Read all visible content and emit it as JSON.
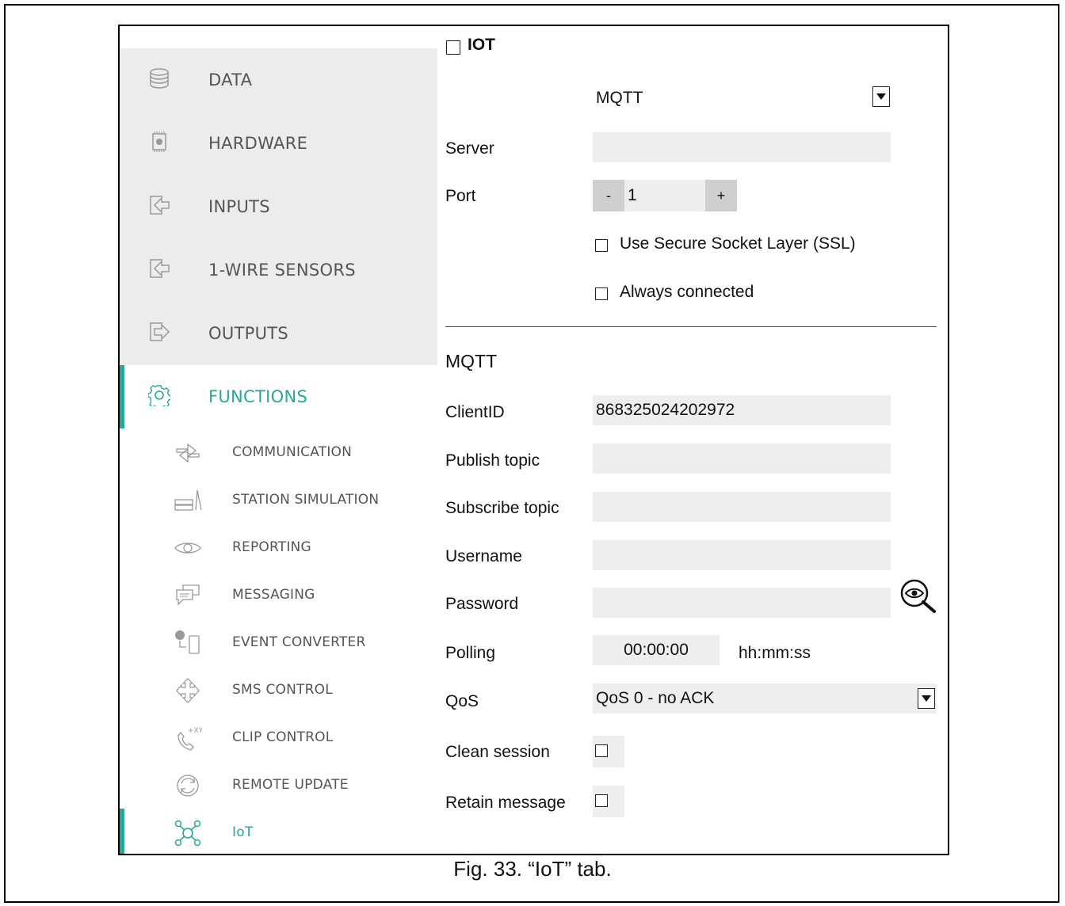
{
  "sidebar": {
    "main_items": [
      {
        "label": "DATA",
        "icon": "database-icon"
      },
      {
        "label": "HARDWARE",
        "icon": "chip-icon"
      },
      {
        "label": "INPUTS",
        "icon": "input-icon"
      },
      {
        "label": "1-WIRE SENSORS",
        "icon": "input-icon"
      },
      {
        "label": "OUTPUTS",
        "icon": "output-icon"
      },
      {
        "label": "FUNCTIONS",
        "icon": "gear-icon"
      }
    ],
    "sub_items": [
      {
        "label": "COMMUNICATION",
        "icon": "communication-icon"
      },
      {
        "label": "STATION SIMULATION",
        "icon": "station-icon"
      },
      {
        "label": "REPORTING",
        "icon": "eye-icon"
      },
      {
        "label": "MESSAGING",
        "icon": "chat-icon"
      },
      {
        "label": "EVENT CONVERTER",
        "icon": "phone-converter-icon"
      },
      {
        "label": "SMS CONTROL",
        "icon": "sms-icon"
      },
      {
        "label": "CLIP CONTROL",
        "icon": "clip-phone-icon"
      },
      {
        "label": "REMOTE UPDATE",
        "icon": "update-icon"
      },
      {
        "label": "IoT",
        "icon": "iot-icon"
      }
    ],
    "active_color": "#2aa79b"
  },
  "iot": {
    "checkbox_label": "IOT",
    "protocol": "MQTT",
    "server_label": "Server",
    "server_value": "",
    "port_label": "Port",
    "port_minus": "-",
    "port_value": "1",
    "port_plus": "+",
    "ssl_label": "Use Secure Socket Layer (SSL)",
    "always_label": "Always connected"
  },
  "mqtt": {
    "heading": "MQTT",
    "clientid_label": "ClientID",
    "clientid_value": "868325024202972",
    "publish_label": "Publish topic",
    "publish_value": "",
    "subscribe_label": "Subscribe topic",
    "subscribe_value": "",
    "username_label": "Username",
    "username_value": "",
    "password_label": "Password",
    "password_value": "",
    "polling_label": "Polling",
    "polling_value": "00:00:00",
    "polling_unit": "hh:mm:ss",
    "qos_label": "QoS",
    "qos_value": "QoS 0 - no ACK",
    "clean_label": "Clean session",
    "retain_label": "Retain message"
  },
  "caption": "Fig. 33. “IoT” tab."
}
